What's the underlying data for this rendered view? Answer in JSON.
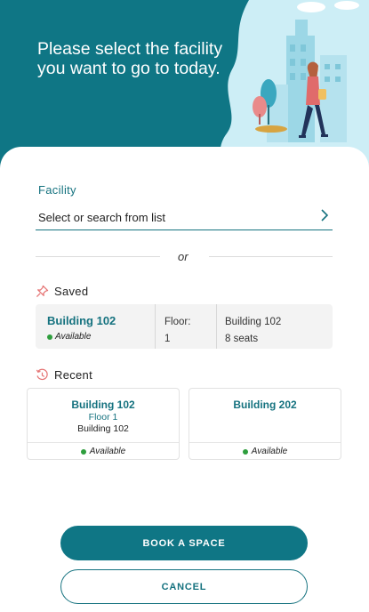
{
  "hero": {
    "title": "Please select the facility you want to go to today."
  },
  "facility": {
    "label": "Facility",
    "placeholder": "Select or search from list"
  },
  "divider": {
    "text": "or"
  },
  "saved": {
    "heading": "Saved",
    "card": {
      "building": "Building 102",
      "status": "Available",
      "floor_label": "Floor:",
      "floor_value": "1",
      "building_label": "Building 102",
      "seats": "8 seats"
    }
  },
  "recent": {
    "heading": "Recent",
    "cards": [
      {
        "building": "Building 102",
        "floor": "Floor 1",
        "building_sub": "Building 102",
        "status": "Available"
      },
      {
        "building": "Building 202",
        "floor": "",
        "building_sub": "",
        "status": "Available"
      }
    ]
  },
  "actions": {
    "book": "BOOK A SPACE",
    "cancel": "CANCEL"
  },
  "colors": {
    "primary": "#0f7685",
    "accent_text": "#15727f",
    "available": "#2e9e3d",
    "saved_icon": "#e57373"
  }
}
